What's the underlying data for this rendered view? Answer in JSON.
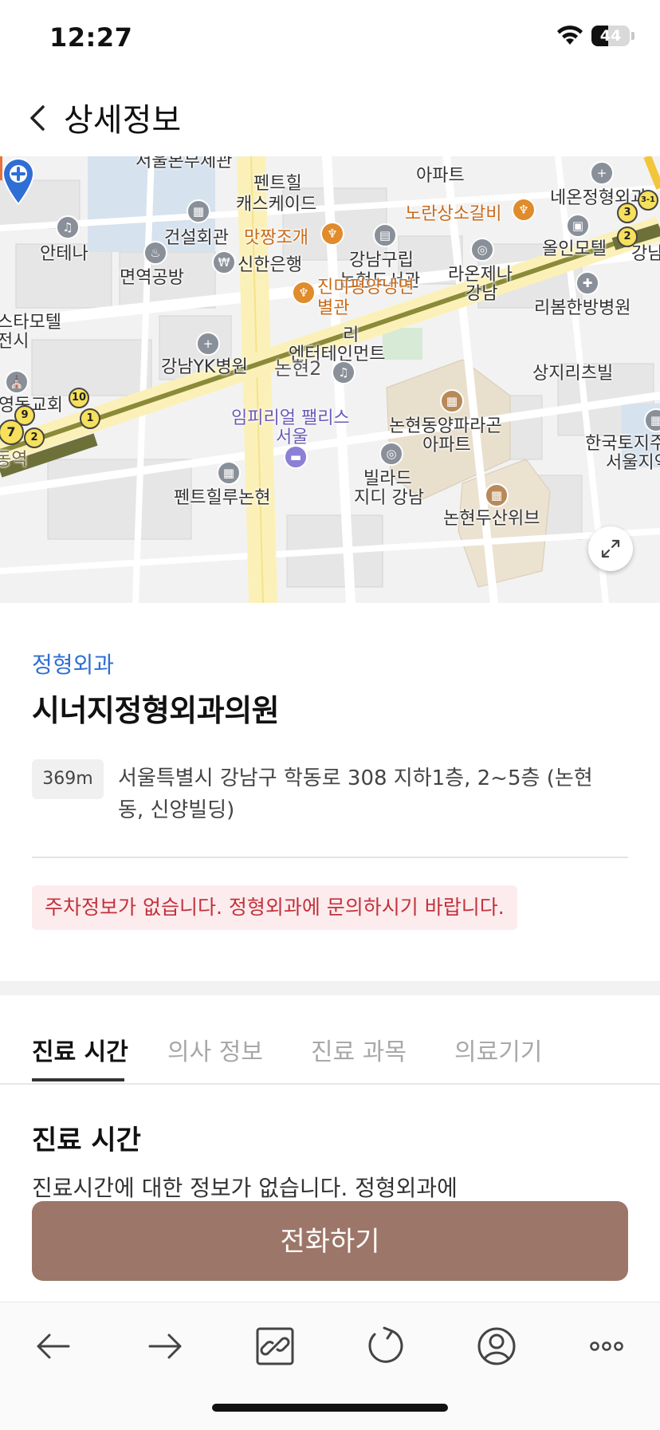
{
  "status_bar": {
    "time": "12:27",
    "battery": "44",
    "battery_level": 0.44
  },
  "header": {
    "title": "상세정보"
  },
  "map": {
    "labels": {
      "l1": "펜트힐",
      "l2": "캐스케이드",
      "l3": "아파트",
      "l4": "네온정형외과",
      "l5": "노란상소갈비",
      "l6": "건설회관",
      "l7": "맛짱조개",
      "l8": "안테나",
      "l9": "신한은행",
      "l10": "강남구립",
      "l11": "논현도서관",
      "l12": "라온제나",
      "l13": "강남",
      "l14": "올인모텔",
      "l15": "강남",
      "l16": "면역공방",
      "l17": "진미평양냉면",
      "l18": "별관",
      "l19": "리봄한방병원",
      "l20": "스타모텔",
      "l21": "전시",
      "l22": "엔터테인먼트",
      "l23": "강남YK병원",
      "l24": "논현2",
      "l25": "상지리츠빌",
      "l26": "영동교회",
      "l27": "임피리얼 팰리스",
      "l28": "서울",
      "l29": "논현동양파라곤",
      "l30": "아파트",
      "l31": "한국토지주",
      "l32": "서울지역",
      "l33": "빌라드",
      "l34": "지디 강남",
      "l35": "펜트힐루논현",
      "l36": "논현두산위브",
      "l37": "동역",
      "l38": "서울본부세관",
      "l39": "리"
    },
    "subway": {
      "s1": "3-1",
      "s2": "3",
      "s3": "2",
      "s4": "10",
      "s5": "9",
      "s6": "1",
      "s7": "7",
      "s8": "2"
    }
  },
  "detail": {
    "category": "정형외과",
    "name": "시너지정형외과의원",
    "distance": "369m",
    "address": "서울특별시 강남구 학동로 308 지하1층, 2~5층 (논현동, 신양빌딩)",
    "parking_notice": "주차정보가 없습니다. 정형외과에 문의하시기 바랍니다."
  },
  "tabs": [
    {
      "label": "진료 시간",
      "active": true
    },
    {
      "label": "의사 정보",
      "active": false
    },
    {
      "label": "진료 과목",
      "active": false
    },
    {
      "label": "의료기기",
      "active": false
    }
  ],
  "section": {
    "title": "진료 시간",
    "body": "진료시간에 대한 정보가 없습니다. 정형외과에"
  },
  "call_button": {
    "label": "전화하기"
  },
  "browser_bar": {
    "icons": [
      "arrow-left-icon",
      "arrow-right-icon",
      "link-icon",
      "refresh-icon",
      "profile-icon",
      "more-icon"
    ]
  },
  "colors": {
    "accent": "#2f6ed4",
    "call_button": "#9c7668",
    "parking_text": "#c2323c",
    "parking_bg": "#fdecee"
  }
}
